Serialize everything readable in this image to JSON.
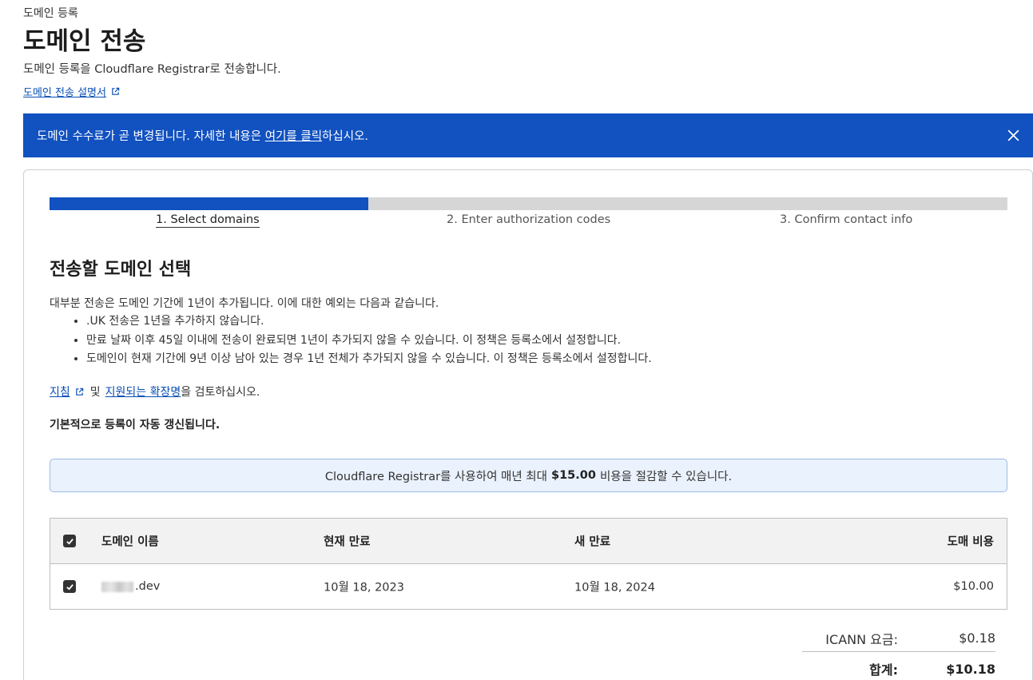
{
  "header": {
    "breadcrumb": "도메인 등록",
    "title": "도메인 전송",
    "subtitle": "도메인 등록을 Cloudflare Registrar로 전송합니다.",
    "doc_link": "도메인 전송 설명서"
  },
  "banner": {
    "text_before": "도메인 수수료가 곧 변경됩니다. 자세한 내용은 ",
    "link": "여기를 클릭",
    "text_after": "하십시오."
  },
  "stepper": {
    "progress": 0.333,
    "steps": [
      "1. Select domains",
      "2. Enter authorization codes",
      "3. Confirm contact info"
    ]
  },
  "section": {
    "title": "전송할 도메인 선택",
    "intro": "대부분 전송은 도메인 기간에 1년이 추가됩니다. 이에 대한 예외는 다음과 같습니다.",
    "bullets": [
      ".UK 전송은 1년을 추가하지 않습니다.",
      "만료 날짜 이후 45일 이내에 전송이 완료되면 1년이 추가되지 않을 수 있습니다. 이 정책은 등록소에서 설정합니다.",
      "도메인이 현재 기간에 9년 이상 남아 있는 경우 1년 전체가 추가되지 않을 수 있습니다. 이 정책은 등록소에서 설정합니다."
    ],
    "guidelines_link": "지침",
    "review_mid": "및",
    "extensions_link": "지원되는 확장명",
    "review_end": "을 검토하십시오.",
    "autorenew": "기본적으로 등록이 자동 갱신됩니다."
  },
  "savings": {
    "before": "Cloudflare Registrar를 사용하여 매년 최대",
    "amount": "$15.00",
    "after": "비용을 절감할 수 있습니다."
  },
  "table": {
    "columns": [
      "도메인 이름",
      "현재 만료",
      "새 만료",
      "도매 비용"
    ],
    "rows": [
      {
        "domain_suffix": ".dev",
        "current_expiry": "10월 18, 2023",
        "new_expiry": "10월 18, 2024",
        "cost": "$10.00",
        "checked": true
      }
    ]
  },
  "summary": {
    "icann_label": "ICANN 요금:",
    "icann_value": "$0.18",
    "total_label": "합계:",
    "total_value": "$10.18"
  },
  "colors": {
    "brand_blue": "#1151c0",
    "link_blue": "#0a4fb5",
    "savings_bg": "#eaf2fd"
  }
}
